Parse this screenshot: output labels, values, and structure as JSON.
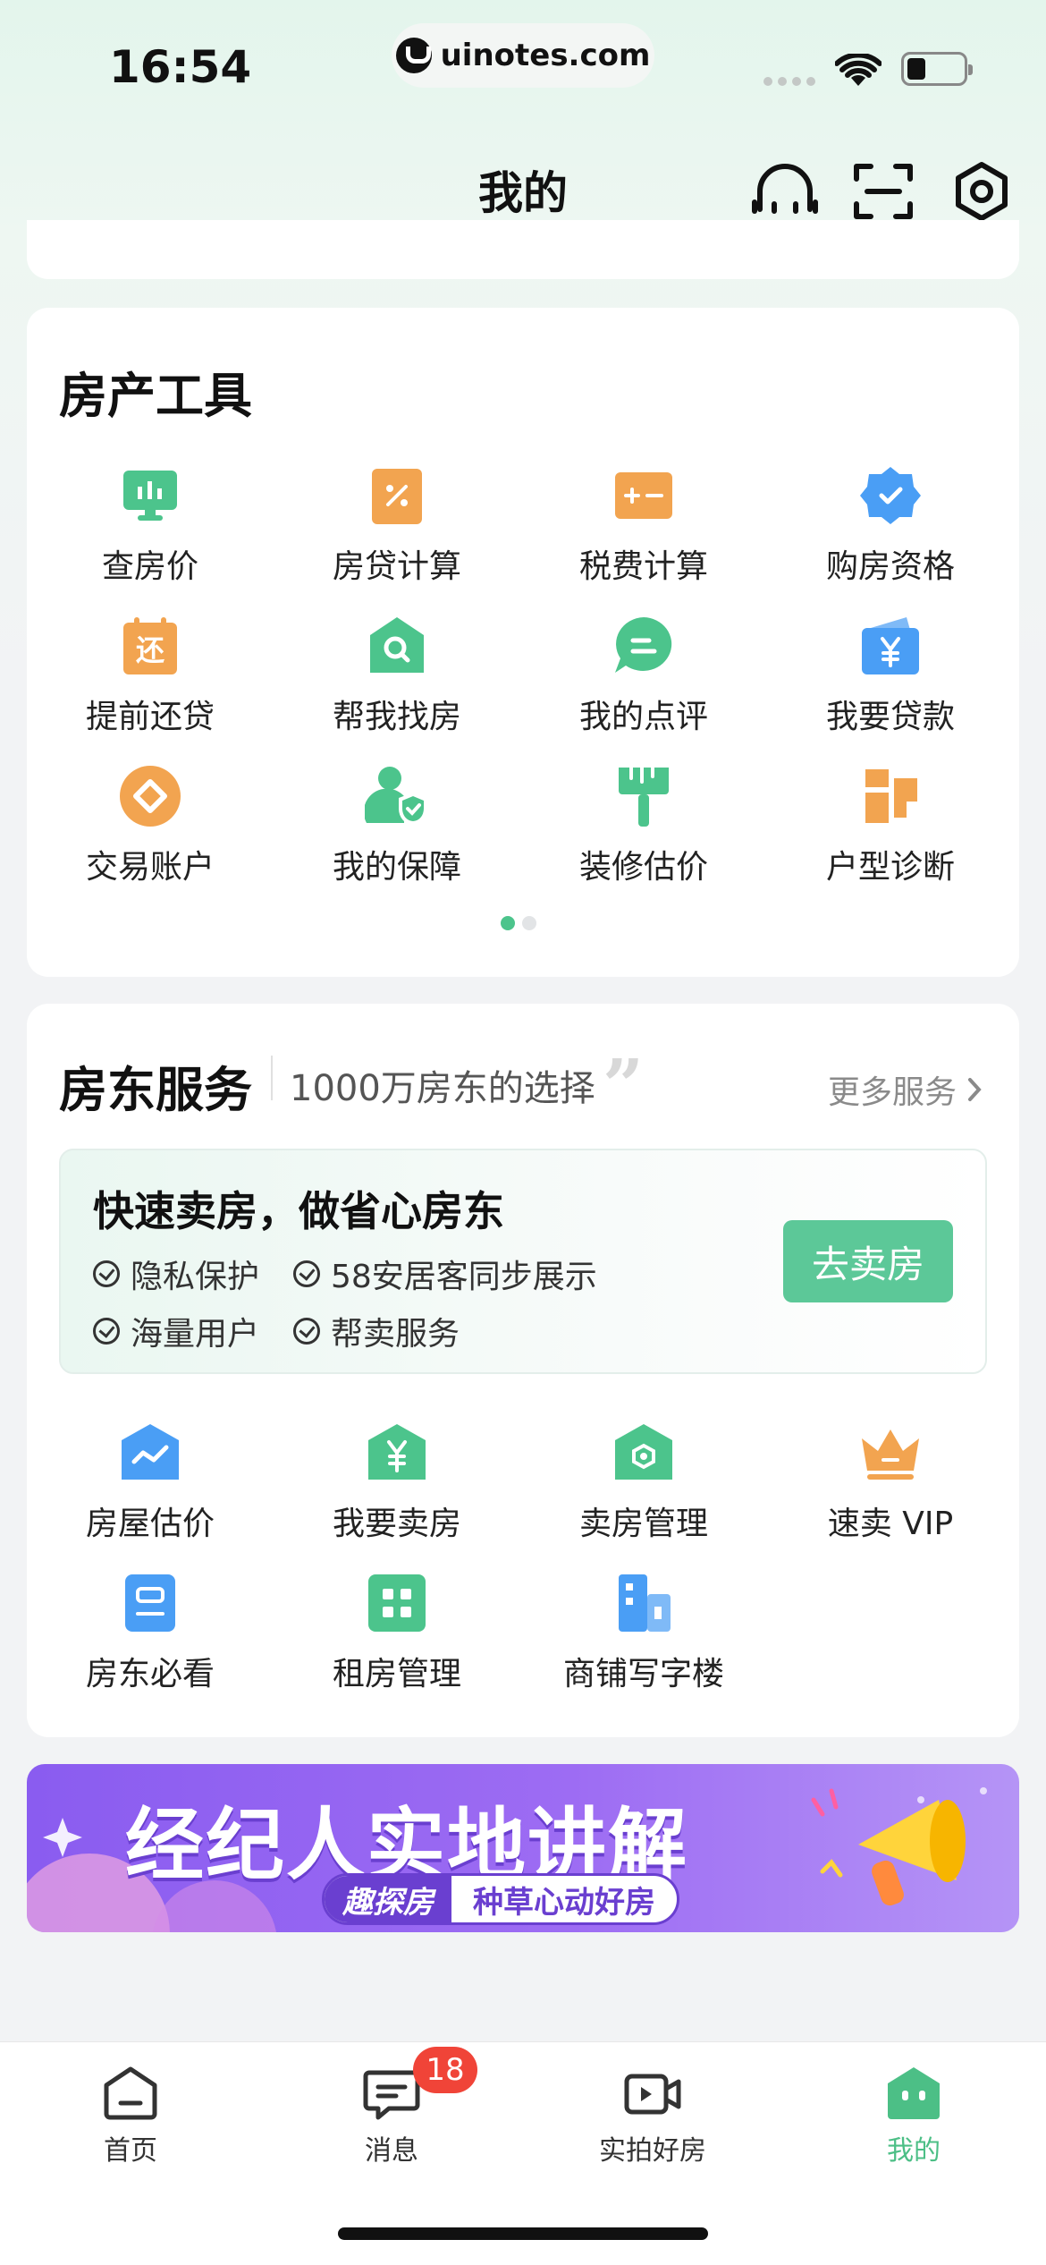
{
  "status_bar": {
    "time": "16:54",
    "url": "uinotes.com"
  },
  "header": {
    "title": "我的"
  },
  "tools": {
    "title": "房产工具",
    "items": [
      {
        "label": "查房价",
        "icon": "price-monitor-icon"
      },
      {
        "label": "房贷计算",
        "icon": "percent-icon"
      },
      {
        "label": "税费计算",
        "icon": "plus-minus-icon"
      },
      {
        "label": "购房资格",
        "icon": "check-badge-icon"
      },
      {
        "label": "提前还贷",
        "icon": "repay-calendar-icon"
      },
      {
        "label": "帮我找房",
        "icon": "house-search-icon"
      },
      {
        "label": "我的点评",
        "icon": "comment-icon"
      },
      {
        "label": "我要贷款",
        "icon": "yen-wallet-icon"
      },
      {
        "label": "交易账户",
        "icon": "account-coin-icon"
      },
      {
        "label": "我的保障",
        "icon": "user-shield-icon"
      },
      {
        "label": "装修估价",
        "icon": "paint-brush-icon"
      },
      {
        "label": "户型诊断",
        "icon": "floorplan-icon"
      }
    ],
    "page_count": 2,
    "active_page": 1
  },
  "landlord": {
    "title": "房东服务",
    "subtitle": "1000万房东的选择",
    "more": "更多服务",
    "promo": {
      "title": "快速卖房，做省心房东",
      "features": [
        "隐私保护",
        "58安居客同步展示",
        "海量用户",
        "帮卖服务"
      ],
      "button": "去卖房"
    },
    "items": [
      {
        "label": "房屋估价",
        "icon": "house-trend-icon"
      },
      {
        "label": "我要卖房",
        "icon": "house-yen-icon"
      },
      {
        "label": "卖房管理",
        "icon": "house-gear-icon"
      },
      {
        "label": "速卖 VIP",
        "icon": "crown-icon"
      },
      {
        "label": "房东必看",
        "icon": "doc-icon"
      },
      {
        "label": "租房管理",
        "icon": "grid-icon"
      },
      {
        "label": "商铺写字楼",
        "icon": "building-icon"
      }
    ]
  },
  "banner": {
    "headline": "经纪人实地讲解",
    "tag": "趣探房",
    "tagline": "种草心动好房"
  },
  "tabbar": {
    "tabs": [
      {
        "label": "首页"
      },
      {
        "label": "消息",
        "badge": "18"
      },
      {
        "label": "实拍好房"
      },
      {
        "label": "我的"
      }
    ],
    "active": "我的"
  },
  "colors": {
    "accent": "#4cbf86",
    "badge": "#f04438",
    "orange": "#f2a450",
    "blue": "#4a9ef5"
  }
}
